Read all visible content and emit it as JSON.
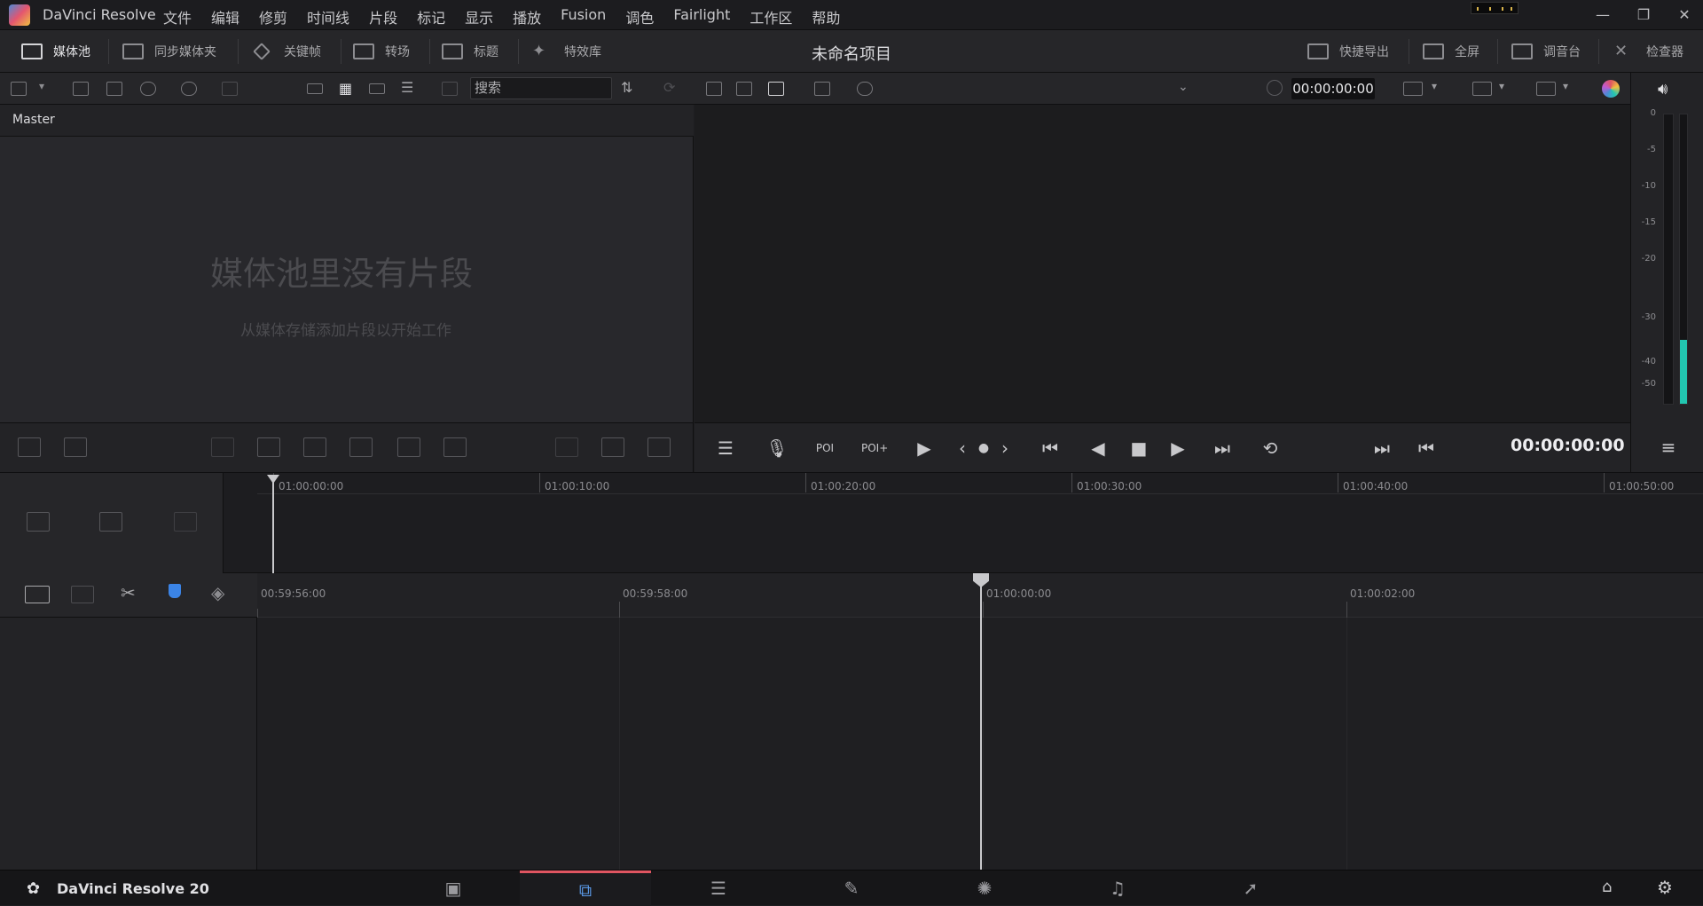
{
  "app": {
    "title": "DaVinci Resolve",
    "menu": [
      "文件",
      "编辑",
      "修剪",
      "时间线",
      "片段",
      "标记",
      "显示",
      "播放",
      "Fusion",
      "调色",
      "Fairlight",
      "工作区",
      "帮助"
    ],
    "window_controls": {
      "minimize": "—",
      "restore": "❐",
      "close": "✕"
    }
  },
  "toolbar": {
    "media_pool": "媒体池",
    "sync_bin": "同步媒体夹",
    "keyframes": "关键帧",
    "transitions": "转场",
    "titles": "标题",
    "effects": "特效库",
    "project_title": "未命名项目",
    "quick_export": "快捷导出",
    "fullscreen": "全屏",
    "mixer": "调音台",
    "inspector": "检查器"
  },
  "secondary": {
    "search_placeholder": "搜索",
    "viewer_timecode": "00:00:00:00"
  },
  "media_pool": {
    "bin_name": "Master",
    "empty_title": "媒体池里没有片段",
    "empty_hint": "从媒体存储添加片段以开始工作"
  },
  "transport": {
    "timecode": "00:00:00:00"
  },
  "meter": {
    "labels": [
      "0",
      "-5",
      "-10",
      "-15",
      "-20",
      "-30",
      "-40",
      "-50"
    ],
    "level": 0.22
  },
  "timeline_upper": {
    "ticks": [
      "01:00:00:00",
      "01:00:10:00",
      "01:00:20:00",
      "01:00:30:00",
      "01:00:40:00",
      "01:00:50:00"
    ]
  },
  "timeline_lower": {
    "ticks": [
      "00:59:56:00",
      "00:59:58:00",
      "01:00:00:00",
      "01:00:02:00"
    ]
  },
  "pagebar": {
    "brand": "DaVinci Resolve 20",
    "pages": [
      "media",
      "cut",
      "edit",
      "fusion",
      "color",
      "fairlight",
      "deliver"
    ],
    "active_page": "cut"
  },
  "colors": {
    "accent": "#e05561",
    "meter_fill": "#22c6b0",
    "timecode_text": "#ededf0"
  }
}
